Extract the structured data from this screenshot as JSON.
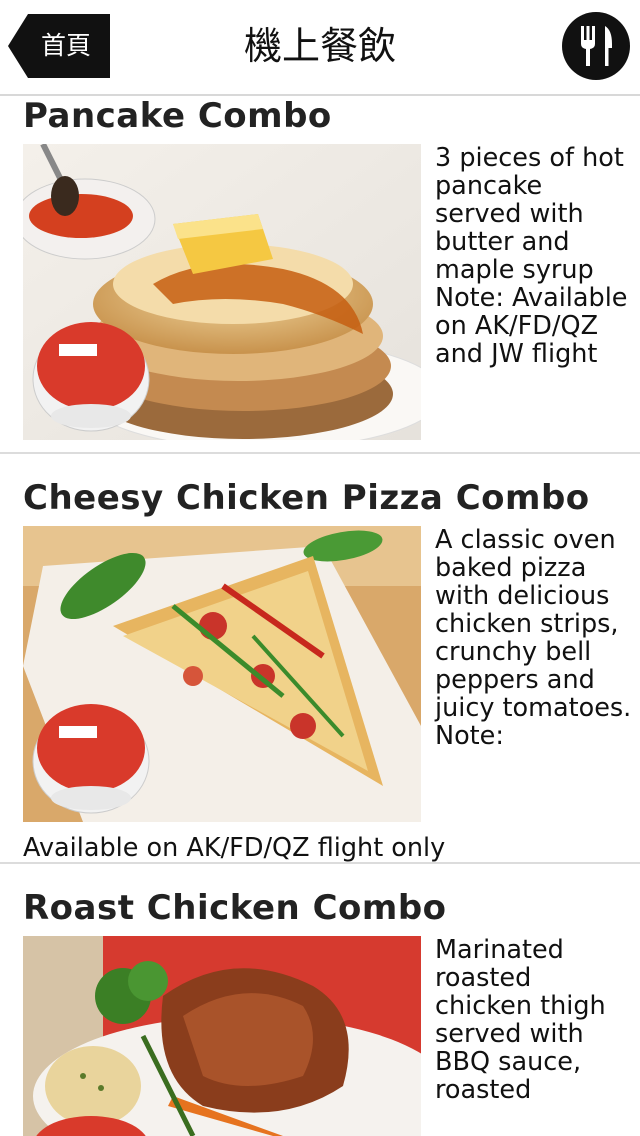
{
  "header": {
    "back_label": "首頁",
    "title": "機上餐飲",
    "menu_icon": "fork-knife-icon"
  },
  "items": [
    {
      "title": "Pancake Combo",
      "description": "3 pieces of hot pancake served with butter and maple syrup Note: Available on AK/FD/QZ and JW flight"
    },
    {
      "title": "Cheesy Chicken Pizza Combo",
      "description": "A classic oven baked pizza with delicious chicken strips, crunchy bell peppers and juicy tomatoes. Note:",
      "description_continued": "Available on AK/FD/QZ flight only"
    },
    {
      "title": "Roast Chicken Combo",
      "description": "Marinated roasted chicken thigh served with BBQ sauce, roasted"
    }
  ],
  "colors": {
    "header_bg": "#ffffff",
    "back_button_bg": "#111111",
    "divider": "#dcdcdc",
    "text": "#111111"
  }
}
